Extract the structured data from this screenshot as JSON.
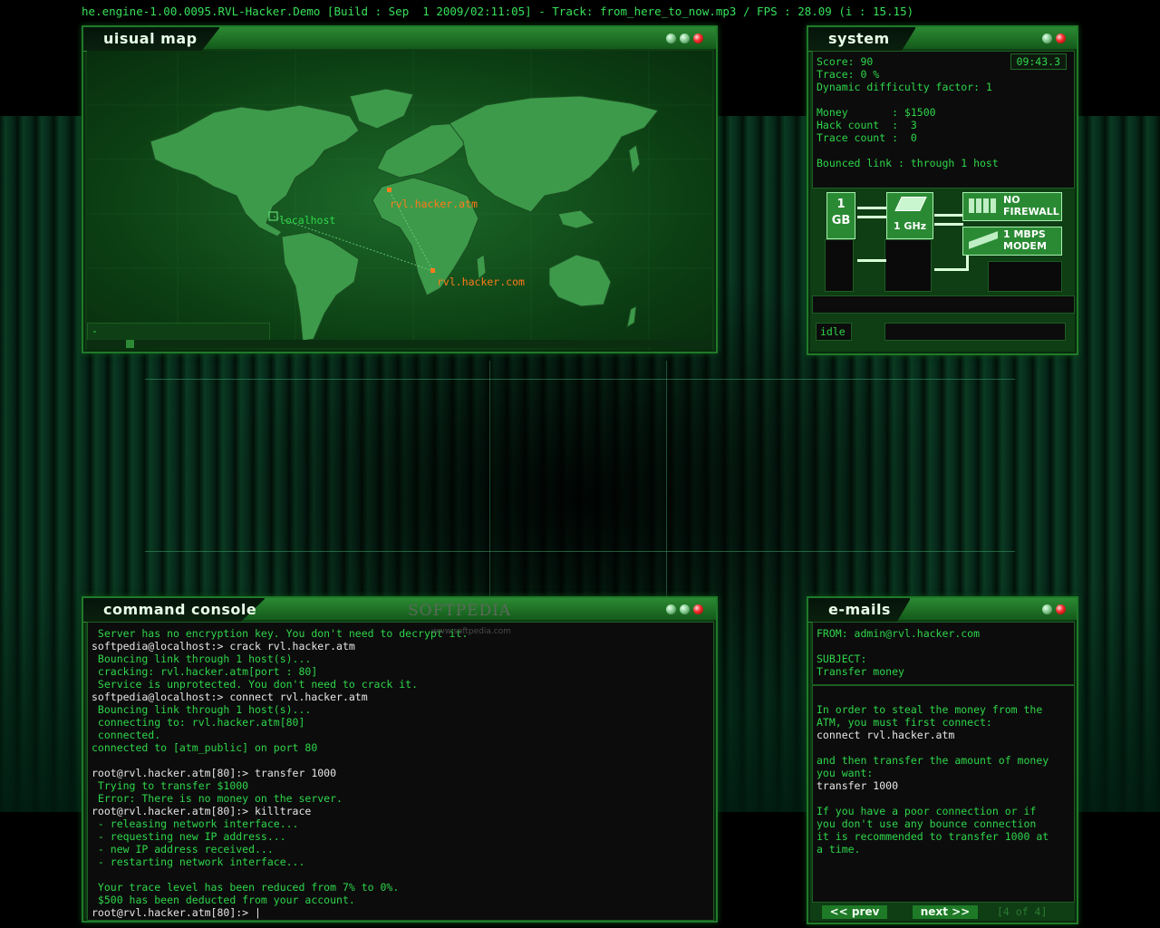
{
  "window": {
    "title": "he.engine-1.00.0095.RVL-Hacker.Demo [Build : Sep  1 2009/02:11:05] - Track: from_here_to_now.mp3 / FPS : 28.09 (i : 15.15)"
  },
  "visual_map": {
    "title": "uisual map",
    "nodes": [
      {
        "label": "localhost",
        "color": "#2fd64a"
      },
      {
        "label": "rvl.hacker.atm",
        "color": "#ff7a1a"
      },
      {
        "label": "rvl.hacker.com",
        "color": "#ff7a1a"
      }
    ],
    "status_text": "-"
  },
  "system": {
    "title": "system",
    "clock": "09:43.3",
    "lines": [
      "Score: 90",
      "Trace: 0 %",
      "Dynamic difficulty factor: 1",
      "",
      "Money       : $1500",
      "Hack count  :  3",
      "Trace count :  0",
      "",
      "Bounced link : through 1 host"
    ],
    "hardware": {
      "ram": "1\nGB",
      "cpu": "1 GHz",
      "firewall": "NO\nFIREWALL",
      "modem": "1 MBPS\nMODEM"
    },
    "status": "idle"
  },
  "console": {
    "title": "command console",
    "watermark": "SOFTPEDIA",
    "watermark_sub": "www.softpedia.com",
    "lines": [
      " Server has no encryption key. You don't need to decrypt it.",
      "softpedia@localhost:> crack rvl.hacker.atm",
      " Bouncing link through 1 host(s)...",
      " cracking: rvl.hacker.atm[port : 80]",
      " Service is unprotected. You don't need to crack it.",
      "softpedia@localhost:> connect rvl.hacker.atm",
      " Bouncing link through 1 host(s)...",
      " connecting to: rvl.hacker.atm[80]",
      " connected.",
      "connected to [atm_public] on port 80",
      "",
      "root@rvl.hacker.atm[80]:> transfer 1000",
      " Trying to transfer $1000",
      " Error: There is no money on the server.",
      "root@rvl.hacker.atm[80]:> killtrace",
      " - releasing network interface...",
      " - requesting new IP address...",
      " - new IP address received...",
      " - restarting network interface...",
      "",
      " Your trace level has been reduced from 7% to 0%.",
      " $500 has been deducted from your account.",
      "root@rvl.hacker.atm[80]:> |"
    ],
    "white_lines": [
      1,
      5,
      11,
      14,
      22
    ]
  },
  "emails": {
    "title": "e-mails",
    "from": "FROM: admin@rvl.hacker.com",
    "subject_label": "SUBJECT:",
    "subject": "Transfer money",
    "body": [
      {
        "t": "In order to steal the money from the",
        "w": false
      },
      {
        "t": "ATM, you must first connect:",
        "w": false
      },
      {
        "t": "connect rvl.hacker.atm",
        "w": true
      },
      {
        "t": "",
        "w": false
      },
      {
        "t": "and then transfer the amount of money",
        "w": false
      },
      {
        "t": "you want:",
        "w": false
      },
      {
        "t": "transfer 1000",
        "w": true
      },
      {
        "t": "",
        "w": false
      },
      {
        "t": "If you have a poor connection or if",
        "w": false
      },
      {
        "t": "you don't use any bounce connection",
        "w": false
      },
      {
        "t": "it is recommended to transfer 1000 at",
        "w": false
      },
      {
        "t": "a time.",
        "w": false
      }
    ],
    "prev_label": "<< prev",
    "next_label": "next >>",
    "pager": "[4 of 4]"
  }
}
